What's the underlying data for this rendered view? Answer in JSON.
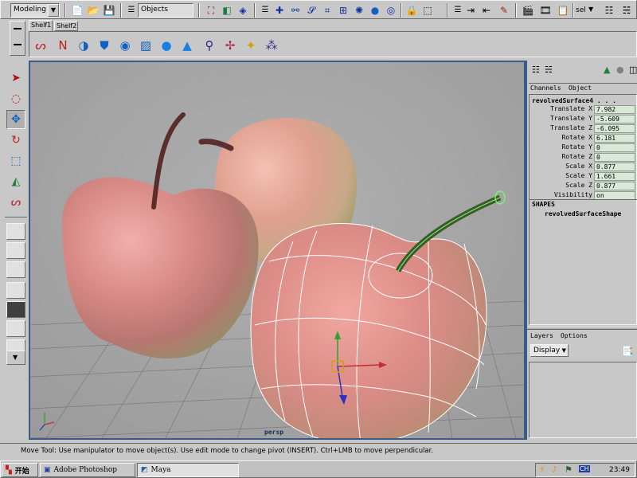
{
  "app": {
    "menu_set": "Modeling",
    "selection_field": "Objects",
    "sel_label": "sel",
    "dropdown_arrow": "▼"
  },
  "shelf": {
    "tabs": [
      {
        "label": "Shelf1"
      },
      {
        "label": "Shelf2"
      }
    ]
  },
  "viewport": {
    "camera_label": "persp"
  },
  "channel_box": {
    "header_channels": "Channels",
    "header_object": "Object",
    "object_name": "revolvedSurface4 . . .",
    "attributes": [
      {
        "label": "Translate X",
        "value": "7.982"
      },
      {
        "label": "Translate Y",
        "value": "-5.609"
      },
      {
        "label": "Translate Z",
        "value": "-6.095"
      },
      {
        "label": "Rotate X",
        "value": "6.181"
      },
      {
        "label": "Rotate Y",
        "value": "0"
      },
      {
        "label": "Rotate Z",
        "value": "0"
      },
      {
        "label": "Scale X",
        "value": "0.877"
      },
      {
        "label": "Scale Y",
        "value": "1.661"
      },
      {
        "label": "Scale Z",
        "value": "0.877"
      },
      {
        "label": "Visibility",
        "value": "on"
      }
    ],
    "shapes_header": "SHAPES",
    "shape_name": "revolvedSurfaceShape"
  },
  "layers": {
    "header_layers": "Layers",
    "header_options": "Options",
    "display_value": "Display"
  },
  "help_line": "Move Tool: Use manipulator to move object(s). Use edit mode to change pivot (INSERT).  Ctrl+LMB to move perpendicular.",
  "taskbar": {
    "start_label": "开始",
    "tasks": [
      {
        "label": "Adobe Photoshop"
      },
      {
        "label": "Maya"
      }
    ],
    "tray_ime": "CH",
    "clock": "23:49"
  }
}
